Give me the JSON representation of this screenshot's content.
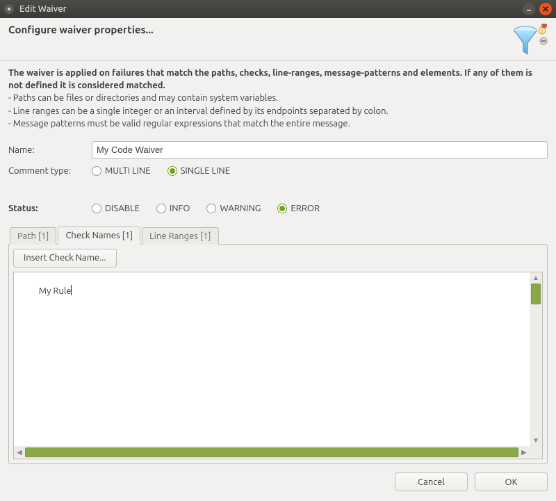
{
  "window": {
    "title": "Edit Waiver"
  },
  "heading": "Configure waiver properties...",
  "description": {
    "bold": "The waiver is applied on failures that match the paths, checks, line-ranges, message-patterns and elements. If any of them is not defined it is considered matched.",
    "bullets": [
      "- Paths can be files or directories and may contain system variables.",
      "- Line ranges can be a single integer or an interval defined by its endpoints separated by colon.",
      "- Message patterns must be valid regular expressions that match the entire message."
    ]
  },
  "form": {
    "name_label": "Name:",
    "name_value": "My Code Waiver",
    "comment_type_label": "Comment type:",
    "comment_type_options": {
      "multi": "MULTI LINE",
      "single": "SINGLE LINE"
    },
    "comment_type_selected": "single",
    "status_label": "Status:",
    "status_options": {
      "disable": "DISABLE",
      "info": "INFO",
      "warning": "WARNING",
      "error": "ERROR"
    },
    "status_selected": "error"
  },
  "tabs": {
    "path": "Path [1]",
    "checks": "Check Names [1]",
    "lineranges": "Line Ranges [1]",
    "active": "checks"
  },
  "check_panel": {
    "insert_button": "Insert Check Name...",
    "text": "My Rule"
  },
  "footer": {
    "cancel": "Cancel",
    "ok": "OK"
  }
}
